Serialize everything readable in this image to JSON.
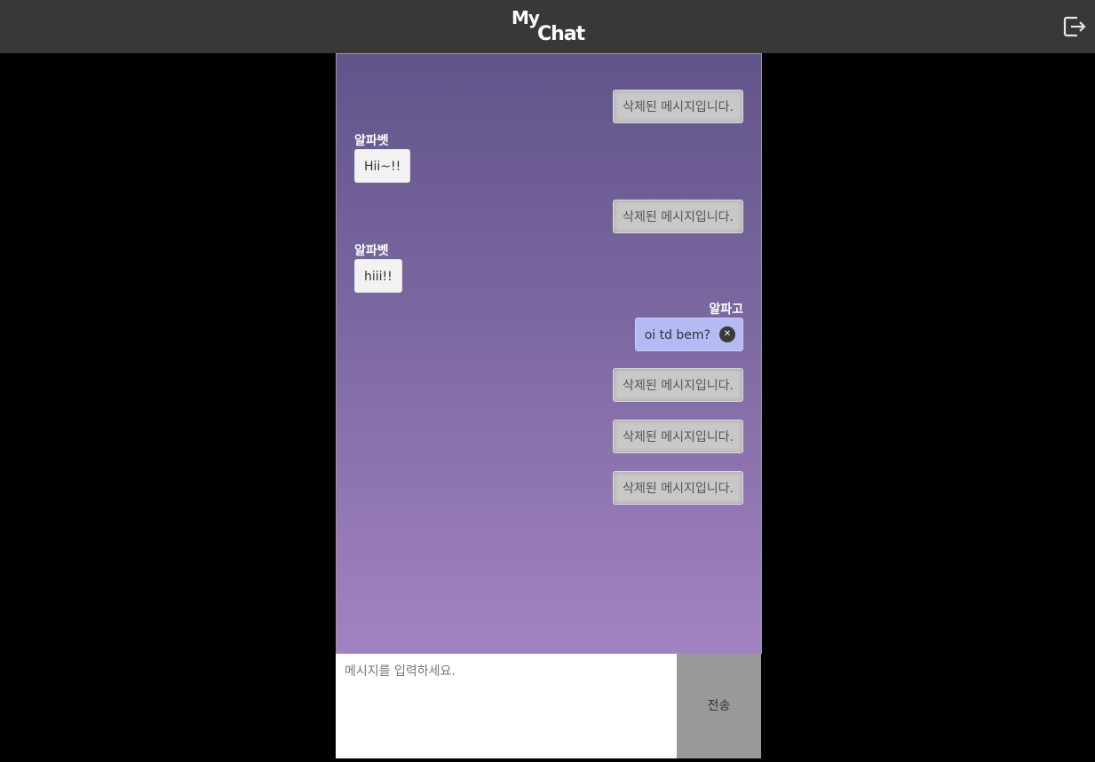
{
  "header": {
    "logo_line1": "My",
    "logo_line2": "Chat",
    "logout_icon": "logout-icon"
  },
  "messages": [
    {
      "side": "right",
      "type": "deleted",
      "text": "삭제된 메시지입니다."
    },
    {
      "side": "left",
      "type": "other",
      "sender": "알파벳",
      "text": "Hii~!!"
    },
    {
      "side": "right",
      "type": "deleted",
      "text": "삭제된 메시지입니다."
    },
    {
      "side": "left",
      "type": "other",
      "sender": "알파벳",
      "text": "hiii!!"
    },
    {
      "side": "right",
      "type": "mine",
      "sender": "알파고",
      "text": "oi td bem?",
      "delete_icon": "close-icon"
    },
    {
      "side": "right",
      "type": "deleted",
      "text": "삭제된 메시지입니다."
    },
    {
      "side": "right",
      "type": "deleted",
      "text": "삭제된 메시지입니다."
    },
    {
      "side": "right",
      "type": "deleted",
      "text": "삭제된 메시지입니다."
    }
  ],
  "composer": {
    "placeholder": "메시지를 입력하세요.",
    "value": "",
    "send_label": "전송"
  },
  "colors": {
    "topbar": "#383838",
    "page_background": "#000000",
    "chat_gradient_top": "#615489",
    "chat_gradient_bottom": "#a283c2",
    "my_bubble": "#b4bbf4",
    "deleted_bubble": "#c8c8c8",
    "other_bubble": "#f2f2f2",
    "send_button": "#999999"
  }
}
